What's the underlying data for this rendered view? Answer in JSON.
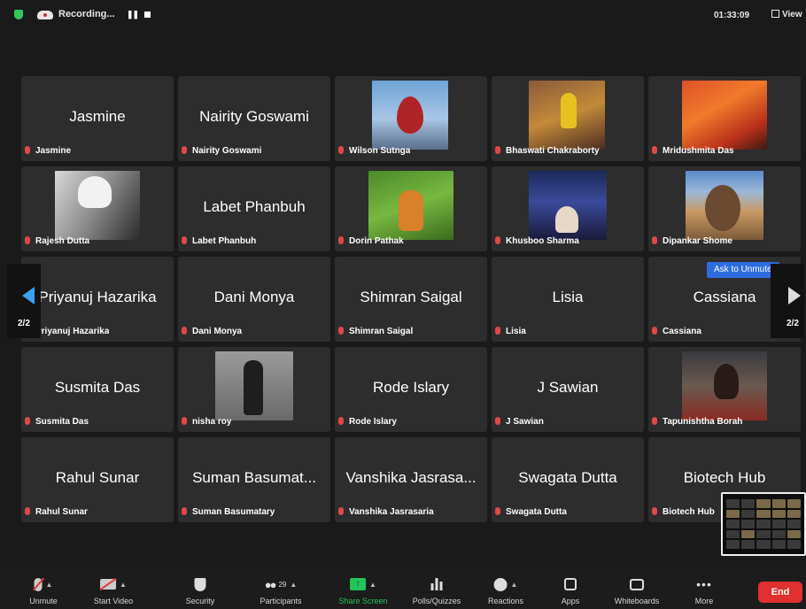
{
  "topbar": {
    "recording_label": "Recording...",
    "timer": "01:33:09",
    "view_label": "View"
  },
  "tiles": [
    {
      "display": "Jasmine",
      "label": "Jasmine"
    },
    {
      "display": "Nairity Goswami",
      "label": "Nairity Goswami"
    },
    {
      "display": "",
      "label": "Wilson Sutnga",
      "photo": "p-leaf"
    },
    {
      "display": "",
      "label": "Bhaswati Chakraborty",
      "photo": "p-bhas"
    },
    {
      "display": "",
      "label": "Mridushmita Das",
      "photo": "p-mrid"
    },
    {
      "display": "",
      "label": "Rajesh Dutta",
      "photo": "p-rajesh"
    },
    {
      "display": "Labet Phanbuh",
      "label": "Labet Phanbuh"
    },
    {
      "display": "",
      "label": "Dorin Pathak",
      "photo": "p-dorin"
    },
    {
      "display": "",
      "label": "Khusboo Sharma",
      "photo": "p-khus"
    },
    {
      "display": "",
      "label": "Dipankar Shome",
      "photo": "p-dipa"
    },
    {
      "display": "Priyanuj Hazarika",
      "label": "Priyanuj Hazarika"
    },
    {
      "display": "Dani Monya",
      "label": "Dani Monya"
    },
    {
      "display": "Shimran Saigal",
      "label": "Shimran Saigal"
    },
    {
      "display": "Lisia",
      "label": "Lisia"
    },
    {
      "display": "Cassiana",
      "label": "Cassiana",
      "ask_unmute": "Ask to Unmute"
    },
    {
      "display": "Susmita Das",
      "label": "Susmita Das"
    },
    {
      "display": "",
      "label": "nisha roy",
      "photo": "p-nisha"
    },
    {
      "display": "Rode Islary",
      "label": "Rode Islary"
    },
    {
      "display": "J Sawian",
      "label": "J Sawian"
    },
    {
      "display": "",
      "label": "Tapunishtha Borah",
      "photo": "p-tapu"
    },
    {
      "display": "Rahul Sunar",
      "label": "Rahul Sunar"
    },
    {
      "display": "Suman Basumat...",
      "label": "Suman Basumatary"
    },
    {
      "display": "Vanshika Jasrasa...",
      "label": "Vanshika Jasrasaria"
    },
    {
      "display": "Swagata Dutta",
      "label": "Swagata Dutta"
    },
    {
      "display": "Biotech Hub",
      "label": "Biotech Hub"
    }
  ],
  "nav": {
    "page_left": "2/2",
    "page_right": "2/2"
  },
  "toolbar": {
    "unmute": "Unmute",
    "start_video": "Start Video",
    "security": "Security",
    "participants": "Participants",
    "participant_count": "29",
    "share_screen": "Share Screen",
    "polls": "Polls/Quizzes",
    "reactions": "Reactions",
    "apps": "Apps",
    "whiteboards": "Whiteboards",
    "more": "More",
    "end": "End"
  },
  "colors": {
    "accent_blue": "#2d6ce0",
    "share_green": "#24c25a",
    "end_red": "#e03030",
    "mute_red": "#e04848"
  }
}
